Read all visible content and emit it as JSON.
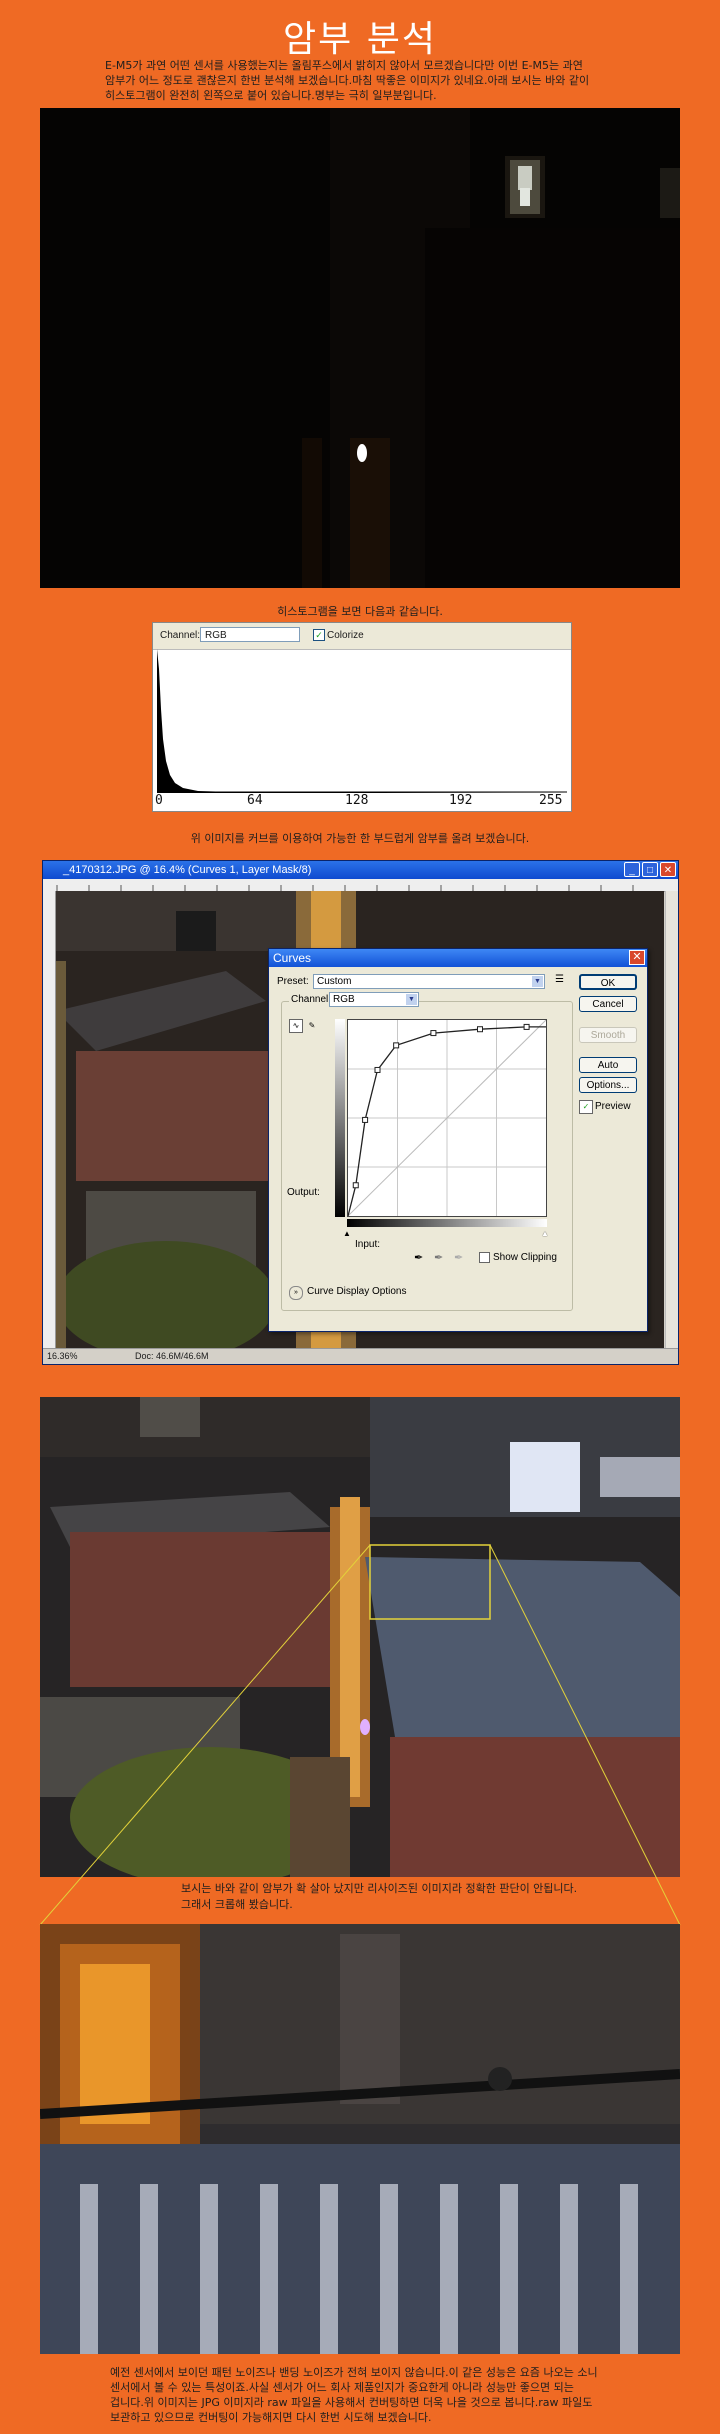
{
  "page": {
    "title": "암부 분석",
    "intro_lines": [
      "E-M5가 과연 어떤 센서를 사용했는지는 올림푸스에서 밝히지 않아서 모르겠습니다만 이번 E-M5는 과연",
      "암부가 어느 정도로 괜찮은지 한번 분석해 보겠습니다.마침 딱좋은 이미지가 있네요.아래 보시는 바와 같이",
      "히스토그램이 완전히 왼쪽으로 붙어 있습니다.명부는 극히 일부분입니다."
    ],
    "caption_histogram": "히스토그램을 보면 다음과 같습니다.",
    "caption_curves": "위 이미지를 커브를 이용하여 가능한 한 부드럽게 암부를 올려 보겠습니다.",
    "caption_crop_lines": [
      "보시는 바와 같이 암부가 확 살아 났지만 리사이즈된 이미지라 정확한 판단이 안됩니다.",
      "그래서 크롭해 봤습니다."
    ],
    "outro_lines": [
      "예전 센서에서 보이던 패턴 노이즈나 밴딩 노이즈가 전혀 보이지 않습니다.이 같은 성능은 요즘 나오는 소니",
      "센서에서 볼 수 있는 특성이죠.사실 센서가 어느 회사 제품인지가 중요한게 아니라 성능만 좋으면 되는",
      "겁니다.위 이미지는 JPG 이미지라 raw 파일을 사용해서 컨버팅하면 더욱 나을 것으로 봅니다.raw 파일도",
      "보관하고 있으므로 컨버팅이 가능해지면 다시 한번 시도해 보겠습니다."
    ]
  },
  "histogram": {
    "channel_label": "Channel:",
    "channel_value": "RGB",
    "colorize_label": "Colorize",
    "colorize_checked": true,
    "axis_ticks": [
      "0",
      "64",
      "128",
      "192",
      "255"
    ]
  },
  "photoshop": {
    "window_title": "_4170312.JPG @ 16.4% (Curves 1, Layer Mask/8)",
    "zoom": "16.36%",
    "doc_size": "Doc: 46.6M/46.6M",
    "ruler_marks": [
      "0",
      "2",
      "4",
      "6",
      "8",
      "10",
      "12",
      "14",
      "16",
      "18",
      "20",
      "22",
      "24",
      "26",
      "28",
      "30",
      "32",
      "34",
      "36"
    ]
  },
  "curves_dialog": {
    "title": "Curves",
    "preset_label": "Preset:",
    "preset_value": "Custom",
    "channel_label": "Channel:",
    "channel_value": "RGB",
    "output_label": "Output:",
    "input_label": "Input:",
    "show_clipping_label": "Show Clipping",
    "curve_display_options_label": "Curve Display Options",
    "buttons": {
      "ok": "OK",
      "cancel": "Cancel",
      "smooth": "Smooth",
      "auto": "Auto",
      "options": "Options..."
    },
    "preview_label": "Preview",
    "preview_checked": true,
    "curve_points": [
      [
        0,
        0
      ],
      [
        10,
        40
      ],
      [
        22,
        125
      ],
      [
        38,
        190
      ],
      [
        62,
        222
      ],
      [
        110,
        238
      ],
      [
        170,
        243
      ],
      [
        230,
        246
      ],
      [
        255,
        246
      ]
    ]
  },
  "colors": {
    "background": "#ef6a24",
    "title": "#ffffff",
    "crop_frame": "#e3d23a"
  }
}
